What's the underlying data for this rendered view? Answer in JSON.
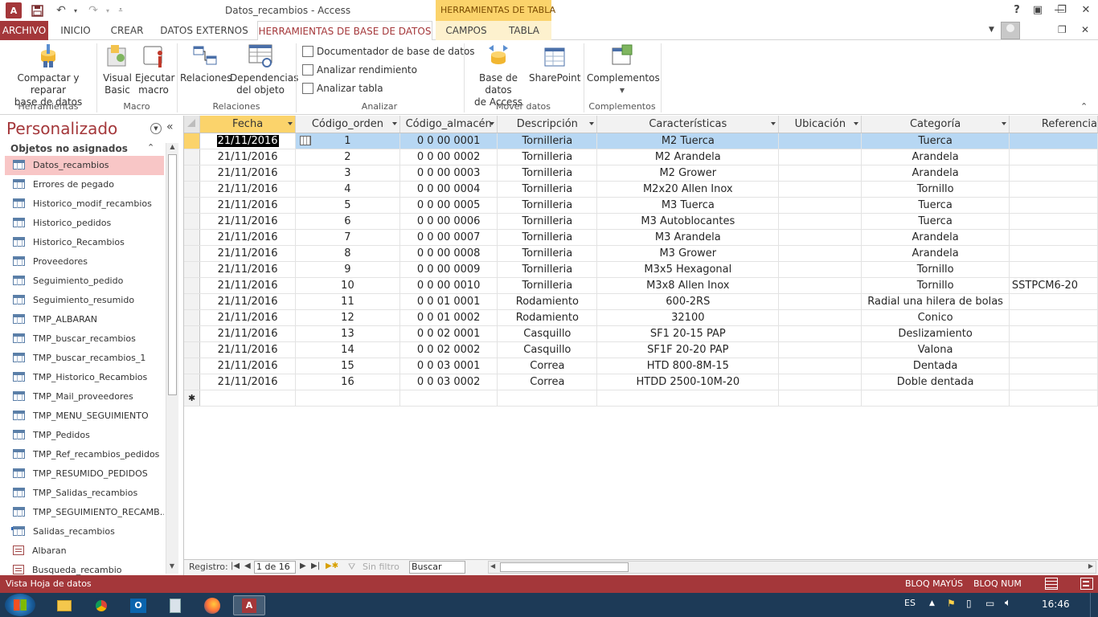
{
  "titlebar": {
    "title": "Datos_recambios - Access",
    "context_tab_title": "HERRAMIENTAS DE TABLA",
    "help": "?"
  },
  "tabs": [
    {
      "label": "ARCHIVO",
      "active": false,
      "file": true
    },
    {
      "label": "INICIO"
    },
    {
      "label": "CREAR"
    },
    {
      "label": "DATOS EXTERNOS"
    },
    {
      "label": "HERRAMIENTAS DE BASE DE DATOS",
      "active": true
    },
    {
      "label": "CAMPOS"
    },
    {
      "label": "TABLA"
    }
  ],
  "ribbon": {
    "compact": {
      "line1": "Compactar y reparar",
      "line2": "base de datos"
    },
    "visual_basic": {
      "line1": "Visual",
      "line2": "Basic"
    },
    "run_macro": {
      "line1": "Ejecutar",
      "line2": "macro"
    },
    "relations": {
      "line1": "Relaciones"
    },
    "dependencies": {
      "line1": "Dependencias",
      "line2": "del objeto"
    },
    "documenter": "Documentador de base de datos",
    "analyze_perf": "Analizar rendimiento",
    "analyze_table": "Analizar tabla",
    "access_db": {
      "line1": "Base de datos",
      "line2": "de Access"
    },
    "sharepoint": {
      "line1": "SharePoint"
    },
    "addins": {
      "line1": "Complementos"
    },
    "groups": {
      "tools": "Herramientas",
      "macro": "Macro",
      "relations": "Relaciones",
      "analyze": "Analizar",
      "move": "Mover datos",
      "addins": "Complementos"
    }
  },
  "nav": {
    "title": "Personalizado",
    "section": "Objetos no asignados",
    "items": [
      {
        "label": "Datos_recambios",
        "icon": "table",
        "selected": true
      },
      {
        "label": "Errores de pegado",
        "icon": "table"
      },
      {
        "label": "Historico_modif_recambios",
        "icon": "table"
      },
      {
        "label": "Historico_pedidos",
        "icon": "table"
      },
      {
        "label": "Historico_Recambios",
        "icon": "table"
      },
      {
        "label": "Proveedores",
        "icon": "table"
      },
      {
        "label": "Seguimiento_pedido",
        "icon": "table"
      },
      {
        "label": "Seguimiento_resumido",
        "icon": "table"
      },
      {
        "label": "TMP_ALBARAN",
        "icon": "table"
      },
      {
        "label": "TMP_buscar_recambios",
        "icon": "table"
      },
      {
        "label": "TMP_buscar_recambios_1",
        "icon": "table"
      },
      {
        "label": "TMP_Historico_Recambios",
        "icon": "table"
      },
      {
        "label": "TMP_Mail_proveedores",
        "icon": "table"
      },
      {
        "label": "TMP_MENU_SEGUIMIENTO",
        "icon": "table"
      },
      {
        "label": "TMP_Pedidos",
        "icon": "table"
      },
      {
        "label": "TMP_Ref_recambios_pedidos",
        "icon": "table"
      },
      {
        "label": "TMP_RESUMIDO_PEDIDOS",
        "icon": "table"
      },
      {
        "label": "TMP_Salidas_recambios",
        "icon": "table"
      },
      {
        "label": "TMP_SEGUIMIENTO_RECAMB...",
        "icon": "table"
      },
      {
        "label": "Salidas_recambios",
        "icon": "linked-table"
      },
      {
        "label": "Albaran",
        "icon": "form"
      },
      {
        "label": "Busqueda_recambio",
        "icon": "form"
      }
    ]
  },
  "grid": {
    "columns": [
      "Fecha",
      "Código_orden",
      "Código_almacén",
      "Descripción",
      "Características",
      "Ubicación",
      "Categoría",
      "Referencia"
    ],
    "rows": [
      [
        "21/11/2016",
        "1",
        "0 0 00 0001",
        "Tornilleria",
        "M2 Tuerca",
        "",
        "Tuerca",
        ""
      ],
      [
        "21/11/2016",
        "2",
        "0 0 00 0002",
        "Tornilleria",
        "M2 Arandela",
        "",
        "Arandela",
        ""
      ],
      [
        "21/11/2016",
        "3",
        "0 0 00 0003",
        "Tornilleria",
        "M2 Grower",
        "",
        "Arandela",
        ""
      ],
      [
        "21/11/2016",
        "4",
        "0 0 00 0004",
        "Tornilleria",
        "M2x20 Allen Inox",
        "",
        "Tornillo",
        ""
      ],
      [
        "21/11/2016",
        "5",
        "0 0 00 0005",
        "Tornilleria",
        "M3 Tuerca",
        "",
        "Tuerca",
        ""
      ],
      [
        "21/11/2016",
        "6",
        "0 0 00 0006",
        "Tornilleria",
        "M3 Autoblocantes",
        "",
        "Tuerca",
        ""
      ],
      [
        "21/11/2016",
        "7",
        "0 0 00 0007",
        "Tornilleria",
        "M3 Arandela",
        "",
        "Arandela",
        ""
      ],
      [
        "21/11/2016",
        "8",
        "0 0 00 0008",
        "Tornilleria",
        "M3 Grower",
        "",
        "Arandela",
        ""
      ],
      [
        "21/11/2016",
        "9",
        "0 0 00 0009",
        "Tornilleria",
        "M3x5 Hexagonal",
        "",
        "Tornillo",
        ""
      ],
      [
        "21/11/2016",
        "10",
        "0 0 00 0010",
        "Tornilleria",
        "M3x8 Allen Inox",
        "",
        "Tornillo",
        "SSTPCM6-20"
      ],
      [
        "21/11/2016",
        "11",
        "0 0 01 0001",
        "Rodamiento",
        "600-2RS",
        "",
        "Radial una hilera de bolas",
        ""
      ],
      [
        "21/11/2016",
        "12",
        "0 0 01 0002",
        "Rodamiento",
        "32100",
        "",
        "Conico",
        ""
      ],
      [
        "21/11/2016",
        "13",
        "0 0 02 0001",
        "Casquillo",
        "SF1 20-15 PAP",
        "",
        "Deslizamiento",
        ""
      ],
      [
        "21/11/2016",
        "14",
        "0 0 02 0002",
        "Casquillo",
        "SF1F 20-20 PAP",
        "",
        "Valona",
        ""
      ],
      [
        "21/11/2016",
        "15",
        "0 0 03 0001",
        "Correa",
        "HTD 800-8M-15",
        "",
        "Dentada",
        ""
      ],
      [
        "21/11/2016",
        "16",
        "0 0 03 0002",
        "Correa",
        "HTDD 2500-10M-20",
        "",
        "Doble dentada",
        ""
      ]
    ],
    "new_row_marker": "✱"
  },
  "recnav": {
    "label": "Registro:",
    "position": "1 de 16",
    "filter": "Sin filtro",
    "search": "Buscar"
  },
  "status": {
    "left": "Vista Hoja de datos",
    "caps": "BLOQ MAYÚS",
    "num": "BLOQ NUM"
  },
  "taskbar": {
    "lang": "ES",
    "time": "16:46"
  },
  "colors": {
    "access_red": "#a4373a",
    "context_tab": "#fbd36b",
    "selection_blue": "#b7d7f3",
    "nav_selected": "#f8c6c6"
  }
}
